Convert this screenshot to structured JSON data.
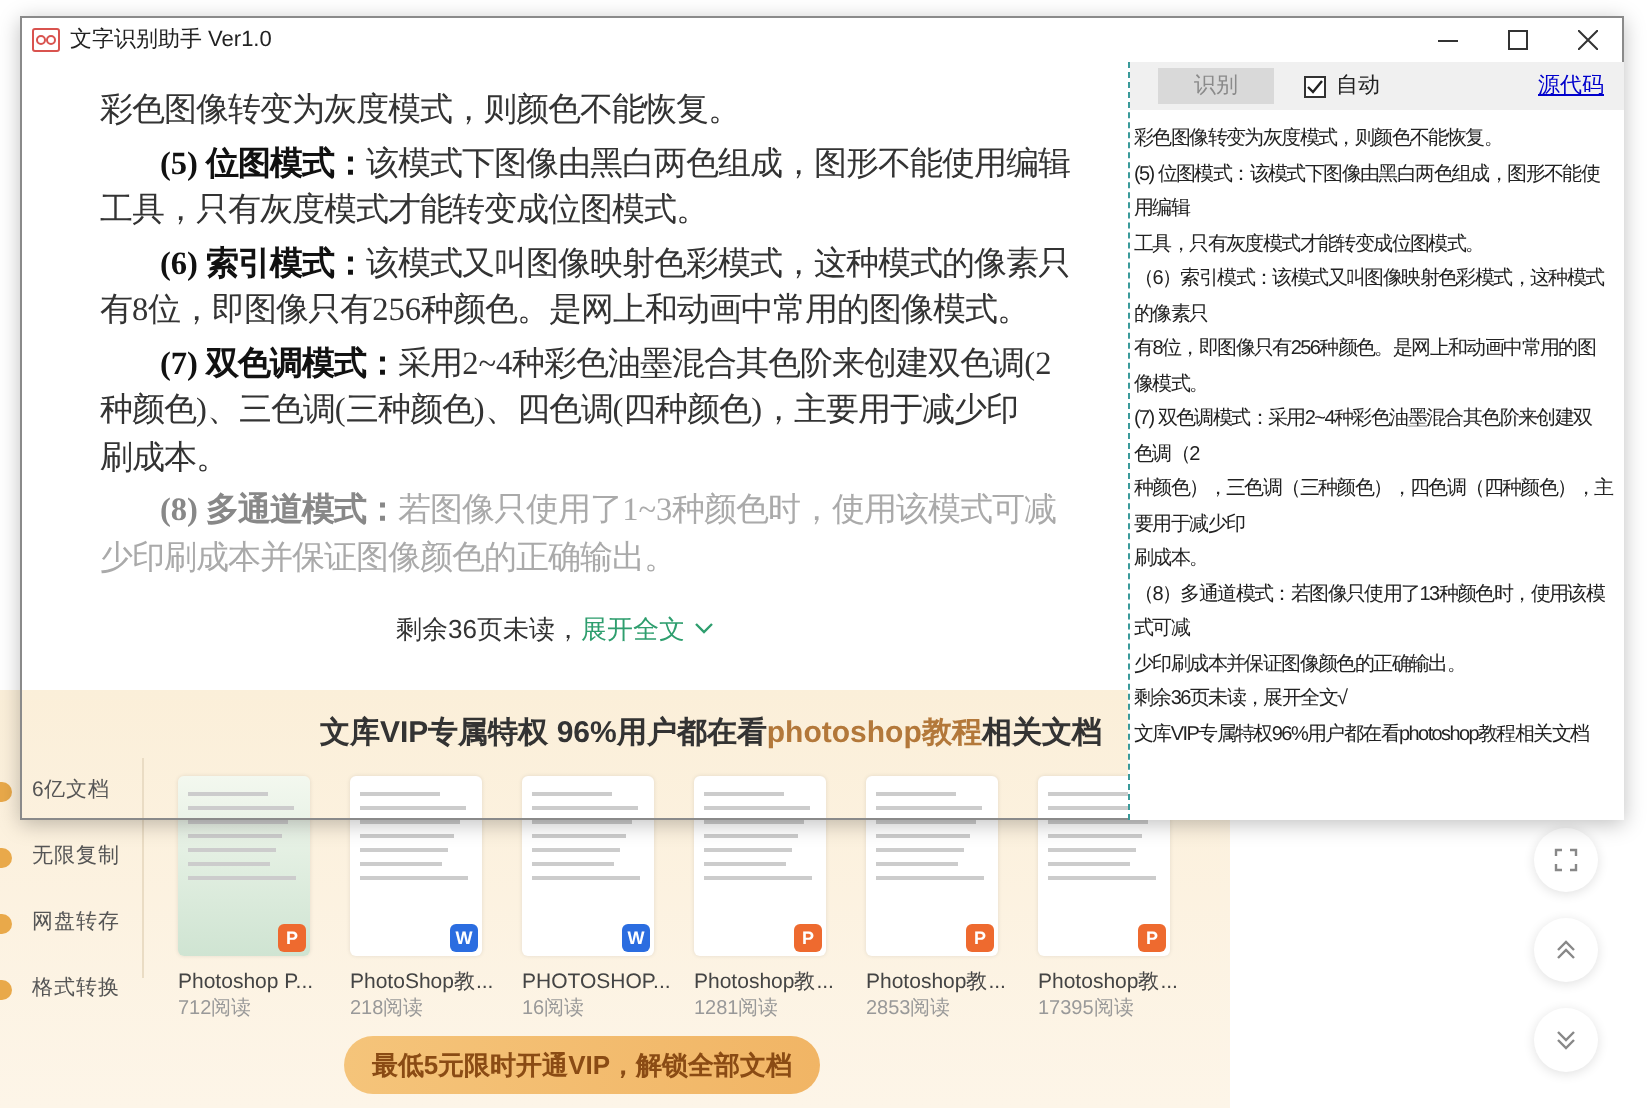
{
  "window": {
    "title": "文字识别助手 Ver1.0"
  },
  "document": {
    "paragraphs": [
      {
        "kind": "continued",
        "faded": false,
        "lines": [
          "彩色图像转变为灰度模式，则颜色不能恢复。"
        ]
      },
      {
        "kind": "heading",
        "faded": false,
        "lines": [
          "**(5) 位图模式：**该模式下图像由黑白两色组成，图形不能使用编辑",
          "工具，只有灰度模式才能转变成位图模式。"
        ]
      },
      {
        "kind": "heading",
        "faded": false,
        "lines": [
          "**(6) 索引模式：**该模式又叫图像映射色彩模式，这种模式的像素只",
          "有8位，即图像只有256种颜色。是网上和动画中常用的图像模式。"
        ]
      },
      {
        "kind": "heading",
        "faded": false,
        "lines": [
          "**(7) 双色调模式：**采用2~4种彩色油墨混合其色阶来创建双色调(2",
          "种颜色)、三色调(三种颜色)、四色调(四种颜色)，主要用于减少印",
          "刷成本。"
        ]
      },
      {
        "kind": "heading",
        "faded": true,
        "lines": [
          "**(8) 多通道模式：**若图像只使用了1~3种颜色时，使用该模式可减",
          "少印刷成本并保证图像颜色的正确输出。"
        ]
      }
    ],
    "remaining": "剩余36页未读，",
    "expand": "展开全文"
  },
  "vip": {
    "title": [
      {
        "text": "文库VIP专属特权 96%用户都在看",
        "highlight": false
      },
      {
        "text": "photoshop教程",
        "highlight": true
      },
      {
        "text": "相关文档",
        "highlight": false
      }
    ],
    "features": [
      "6亿文档",
      "无限复制",
      "网盘转存",
      "格式转换"
    ],
    "documents": [
      {
        "title": "Photoshop P...",
        "reads": "712阅读",
        "badge": "P",
        "color": "#ee6a2f"
      },
      {
        "title": "PhotoShop教...",
        "reads": "218阅读",
        "badge": "W",
        "color": "#2b6de0"
      },
      {
        "title": "PHOTOSHOP...",
        "reads": "16阅读",
        "badge": "W",
        "color": "#2b6de0"
      },
      {
        "title": "Photoshop教...",
        "reads": "1281阅读",
        "badge": "P",
        "color": "#ee6a2f"
      },
      {
        "title": "Photoshop教...",
        "reads": "2853阅读",
        "badge": "P",
        "color": "#ee6a2f"
      },
      {
        "title": "Photoshop教...",
        "reads": "17395阅读",
        "badge": "P",
        "color": "#ee6a2f"
      }
    ],
    "unlock_button": "最低5元限时开通VIP，解锁全部文档"
  },
  "ocr_panel": {
    "recognize_button": {
      "label": "识别",
      "disabled": true
    },
    "auto": {
      "label": "自动",
      "checked": true
    },
    "source_link": "源代码",
    "text_lines": [
      "彩色图像转变为灰度模式，则颜色不能恢复。",
      "(5) 位图模式：该模式下图像由黑白两色组成，图形不能使",
      "用编辑",
      "工具，只有灰度模式才能转变成位图模式。",
      "（6）索引模式：该模式又叫图像映射色彩模式，这种模式",
      "的像素只",
      "有8位，即图像只有256种颜色。是网上和动画中常用的图",
      "像模式。",
      "(7) 双色调模式：采用2~4种彩色油墨混合其色阶来创建双",
      "色调（2",
      "种颜色），三色调（三种颜色），四色调（四种颜色），主",
      "要用于减少印",
      "刷成本。",
      "（8）多通道模式：若图像只使用了13种颜色时，使用该模",
      "式可减",
      "少印刷成本并保证图像颜色的正确输出。",
      "剩余36页未读，展开全文√",
      "文库VIP专属特权96%用户都在看photoshop教程相关文档"
    ]
  }
}
